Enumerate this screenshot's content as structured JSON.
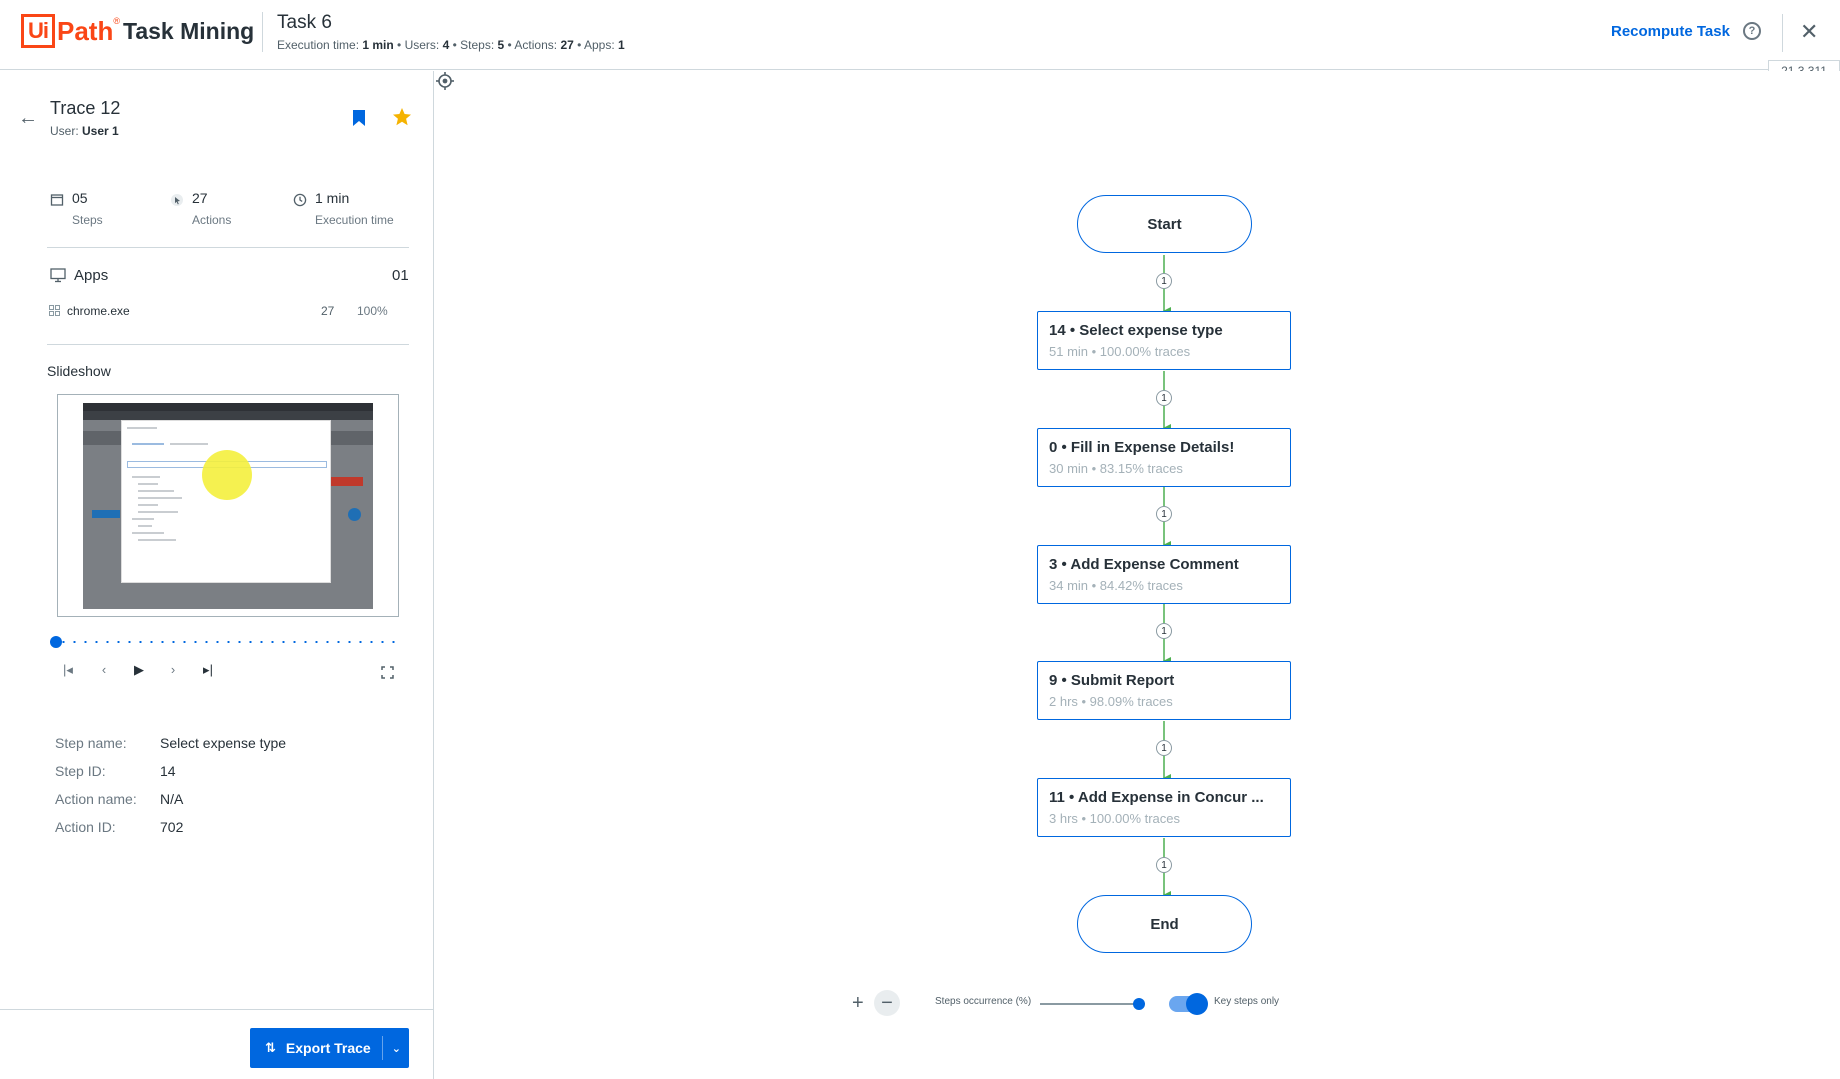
{
  "header": {
    "logo_box": "Ui",
    "logo_path": "Path",
    "logo_reg": "®",
    "product": "Task Mining",
    "task_title": "Task 6",
    "meta": {
      "exec_label": "Execution time: ",
      "exec_value": "1 min",
      "users_label": " • Users: ",
      "users_value": "4",
      "steps_label": " • Steps: ",
      "steps_value": "5",
      "actions_label": " • Actions: ",
      "actions_value": "27",
      "apps_label": " • Apps: ",
      "apps_value": "1"
    },
    "recompute_label": "Recompute Task",
    "help_glyph": "?",
    "close_glyph": "✕",
    "version": "21.3.311"
  },
  "trace": {
    "back_glyph": "←",
    "title": "Trace 12",
    "user_label": "User: ",
    "user_value": "User 1",
    "stats": [
      {
        "value": "05",
        "label": "Steps",
        "icon": "window-icon"
      },
      {
        "value": "27",
        "label": "Actions",
        "icon": "click-icon"
      },
      {
        "value": "1 min",
        "label": "Execution time",
        "icon": "clock-icon"
      }
    ],
    "apps_label": "Apps",
    "apps_count": "01",
    "apps": [
      {
        "name": "chrome.exe",
        "count": "27",
        "percent": "100%"
      }
    ],
    "slideshow_label": "Slideshow",
    "details": [
      {
        "key": "Step name:",
        "value": "Select expense type"
      },
      {
        "key": "Step ID:",
        "value": "14"
      },
      {
        "key": "Action name:",
        "value": "N/A"
      },
      {
        "key": "Action ID:",
        "value": "702"
      }
    ],
    "export_label": "Export Trace",
    "export_icon": "⇅",
    "export_chevron": "⌄"
  },
  "flow": {
    "start": "Start",
    "end": "End",
    "steps": [
      {
        "title": "14 • Select expense type",
        "sub": "51 min • 100.00% traces"
      },
      {
        "title": "0 • Fill in Expense Details!",
        "sub": "30 min • 83.15% traces"
      },
      {
        "title": "3 • Add Expense Comment",
        "sub": "34 min • 84.42% traces"
      },
      {
        "title": "9 • Submit Report",
        "sub": "2 hrs • 98.09% traces"
      },
      {
        "title": "11 • Add Expense in Concur ...",
        "sub": "3 hrs • 100.00% traces"
      }
    ],
    "edge_labels": [
      "1",
      "1",
      "1",
      "1",
      "1",
      "1"
    ],
    "zoom_in": "+",
    "zoom_out": "−",
    "occurrence_label": "Steps occurrence (%)",
    "key_steps_label": "Key steps only",
    "key_steps_on": true,
    "edge_color": "#4caf50",
    "accent_color": "#0067df"
  }
}
